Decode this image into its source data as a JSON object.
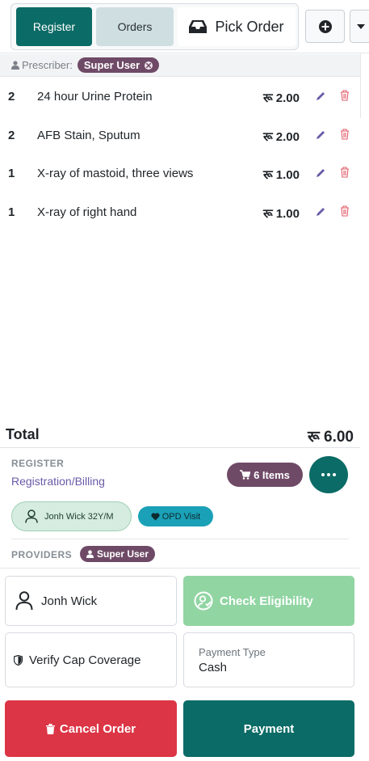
{
  "tabs": {
    "register": "Register",
    "orders": "Orders",
    "pick_order": "Pick Order"
  },
  "colors": {
    "primary": "#0b6b66",
    "accent_purple": "#6f4a67",
    "danger": "#dc3545",
    "success_light": "#91d5a3",
    "info": "#1ba1b7"
  },
  "prescriber": {
    "label": "Prescriber:",
    "value": "Super User"
  },
  "order_lines": [
    {
      "qty": "2",
      "name": "24 hour Urine Protein",
      "price": "रू 2.00"
    },
    {
      "qty": "2",
      "name": "AFB Stain, Sputum",
      "price": "रू 2.00"
    },
    {
      "qty": "1",
      "name": "X-ray of mastoid, three views",
      "price": "रू 1.00"
    },
    {
      "qty": "1",
      "name": "X-ray of right hand",
      "price": "रू 1.00"
    }
  ],
  "total": {
    "label": "Total",
    "value": "रू 6.00"
  },
  "register": {
    "label": "REGISTER",
    "link": "Registration/Billing",
    "items_button": "6 Items"
  },
  "patient": {
    "chip": "Jonh Wick 32Y/M",
    "visit": "OPD Visit"
  },
  "providers": {
    "label": "PROVIDERS",
    "value": "Super User"
  },
  "cards": {
    "patient_name": "Jonh Wick",
    "check_eligibility": "Check Eligibility",
    "verify_cap": "Verify Cap Coverage",
    "payment_type_label": "Payment Type",
    "payment_type_value": "Cash"
  },
  "actions": {
    "cancel": "Cancel Order",
    "payment": "Payment"
  }
}
